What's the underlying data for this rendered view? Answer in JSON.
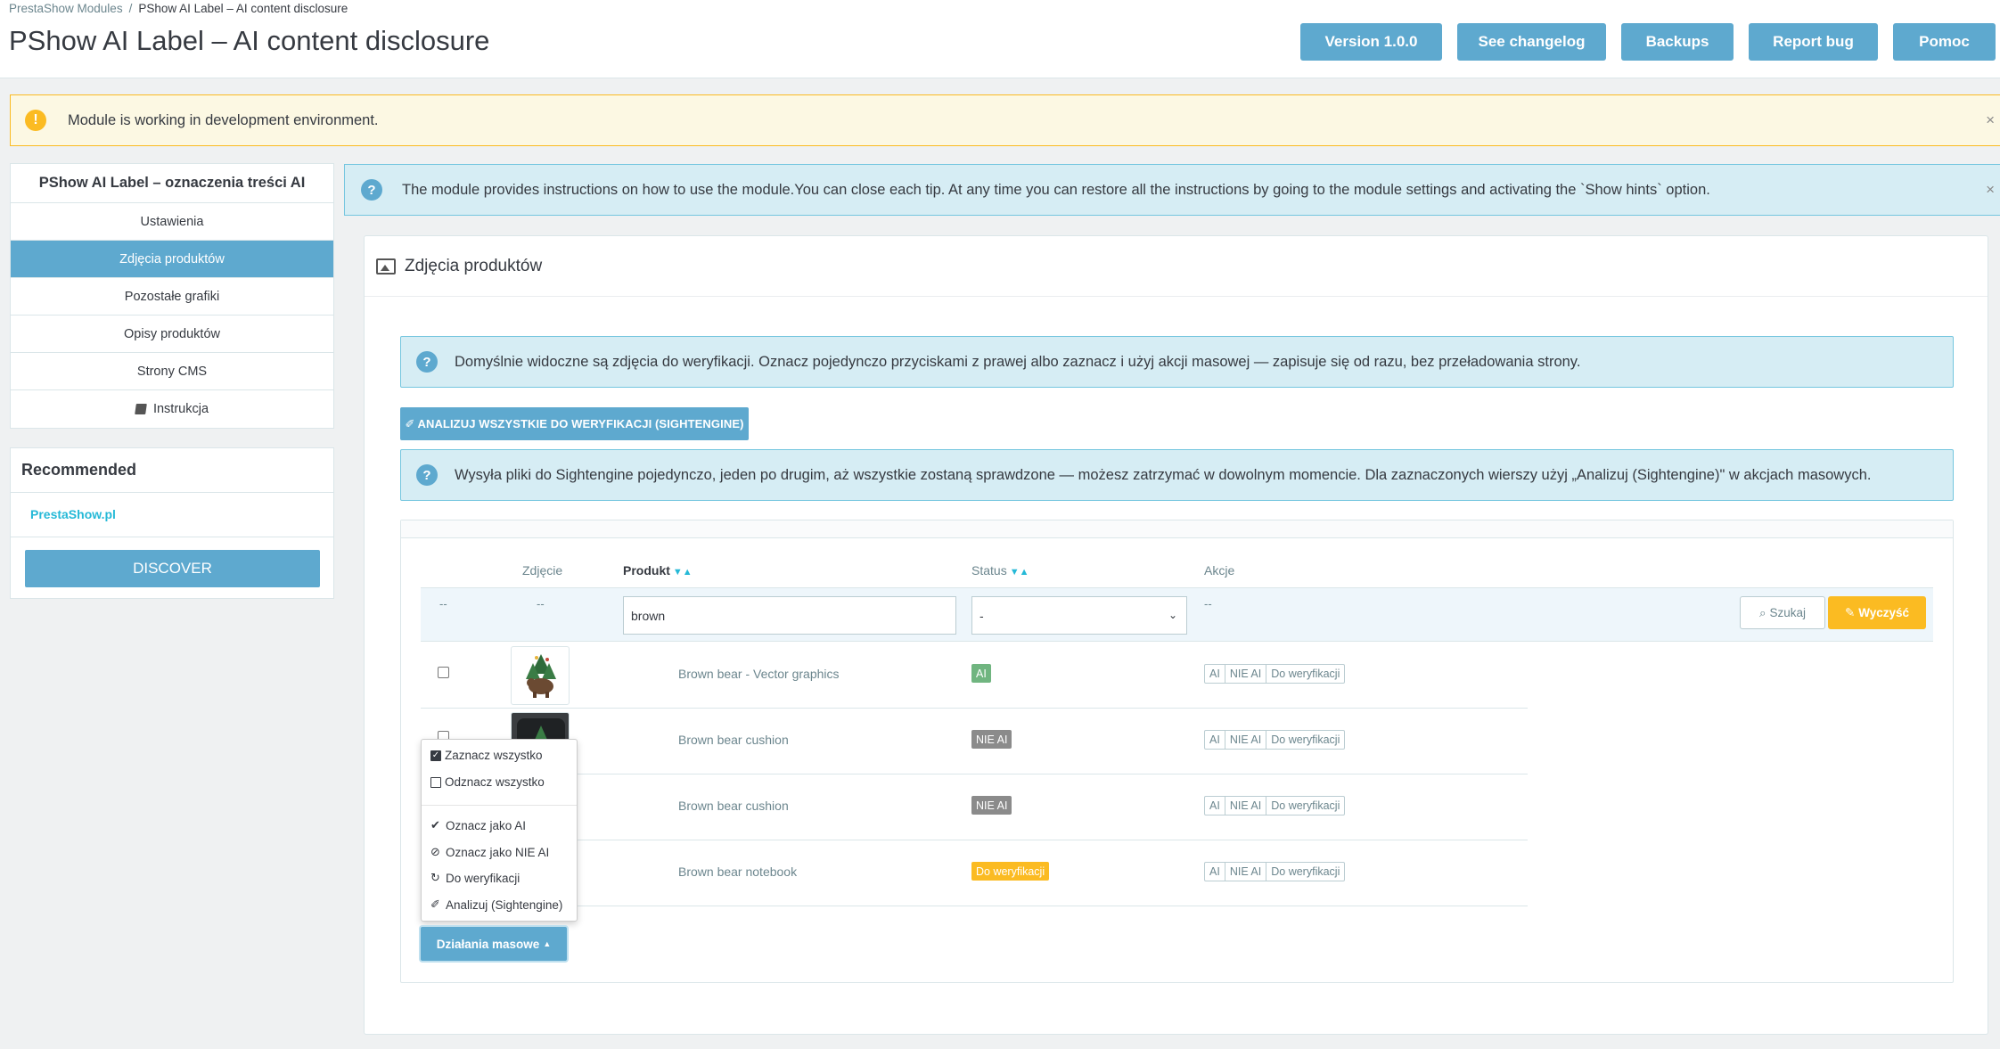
{
  "breadcrumb": {
    "parent": "PrestaShow Modules",
    "separator": "/",
    "current": "PShow AI Label – AI content disclosure"
  },
  "page_title": "PShow AI Label – AI content disclosure",
  "toolbar": {
    "version": "Version 1.0.0",
    "changelog": "See changelog",
    "backups": "Backups",
    "report_bug": "Report bug",
    "help": "Pomoc"
  },
  "dev_warning": {
    "icon": "!",
    "text": "Module is working in development environment.",
    "close": "×"
  },
  "sidebar": {
    "title": "PShow AI Label – oznaczenia treści AI",
    "items": [
      {
        "label": "Ustawienia"
      },
      {
        "label": "Zdjęcia produktów"
      },
      {
        "label": "Pozostałe grafiki"
      },
      {
        "label": "Opisy produktów"
      },
      {
        "label": "Strony CMS"
      },
      {
        "label": "Instrukcja"
      }
    ]
  },
  "recommended": {
    "title": "Recommended",
    "link": "PrestaShow.pl",
    "button": "DISCOVER"
  },
  "tip": {
    "icon": "?",
    "text": "The module provides instructions on how to use the module.You can close each tip. At any time you can restore all the instructions by going to the module settings and activating the `Show hints` option.",
    "close": "×"
  },
  "panel": {
    "title": "Zdjęcia produktów",
    "info1": "Domyślnie widoczne są zdjęcia do weryfikacji. Oznacz pojedynczo przyciskami z prawej albo zaznacz i użyj akcji masowej — zapisuje się od razu, bez przeładowania strony.",
    "analyze_button": "ANALIZUJ WSZYSTKIE DO WERYFIKACJI (SIGHTENGINE)",
    "info2": "Wysyła pliki do Sightengine pojedynczo, jeden po drugim, aż wszystkie zostaną sprawdzone — możesz zatrzymać w dowolnym momencie. Dla zaznaczonych wierszy użyj „Analizuj (Sightengine)\" w akcjach masowych."
  },
  "table": {
    "headers": {
      "image": "Zdjęcie",
      "product": "Produkt",
      "status": "Status",
      "actions": "Akcje"
    },
    "filter": {
      "dash": "--",
      "product_value": "brown",
      "status_value": "-",
      "search": "Szukaj",
      "clear": "Wyczyść"
    },
    "rows": [
      {
        "name": "Brown bear - Vector graphics",
        "status": "AI"
      },
      {
        "name": "Brown bear cushion",
        "status": "NIE AI"
      },
      {
        "name": "Brown bear cushion",
        "status": "NIE AI"
      },
      {
        "name": "Brown bear notebook",
        "status": "Do weryfikacji"
      }
    ],
    "row_actions": {
      "ai": "AI",
      "nie_ai": "NIE AI",
      "do_weryfikacji": "Do weryfikacji"
    }
  },
  "bulk_menu": {
    "select_all": "Zaznacz wszystko",
    "unselect_all": "Odznacz wszystko",
    "mark_ai": "Oznacz jako AI",
    "mark_not_ai": "Oznacz jako NIE AI",
    "to_verify": "Do weryfikacji",
    "analyze": "Analizuj (Sightengine)",
    "button": "Działania masowe"
  },
  "colors": {
    "primary": "#5ea9cf",
    "warning": "#fbbb22",
    "success": "#70b580",
    "muted": "#8b8b8b",
    "info_bg": "#d6edf4"
  }
}
